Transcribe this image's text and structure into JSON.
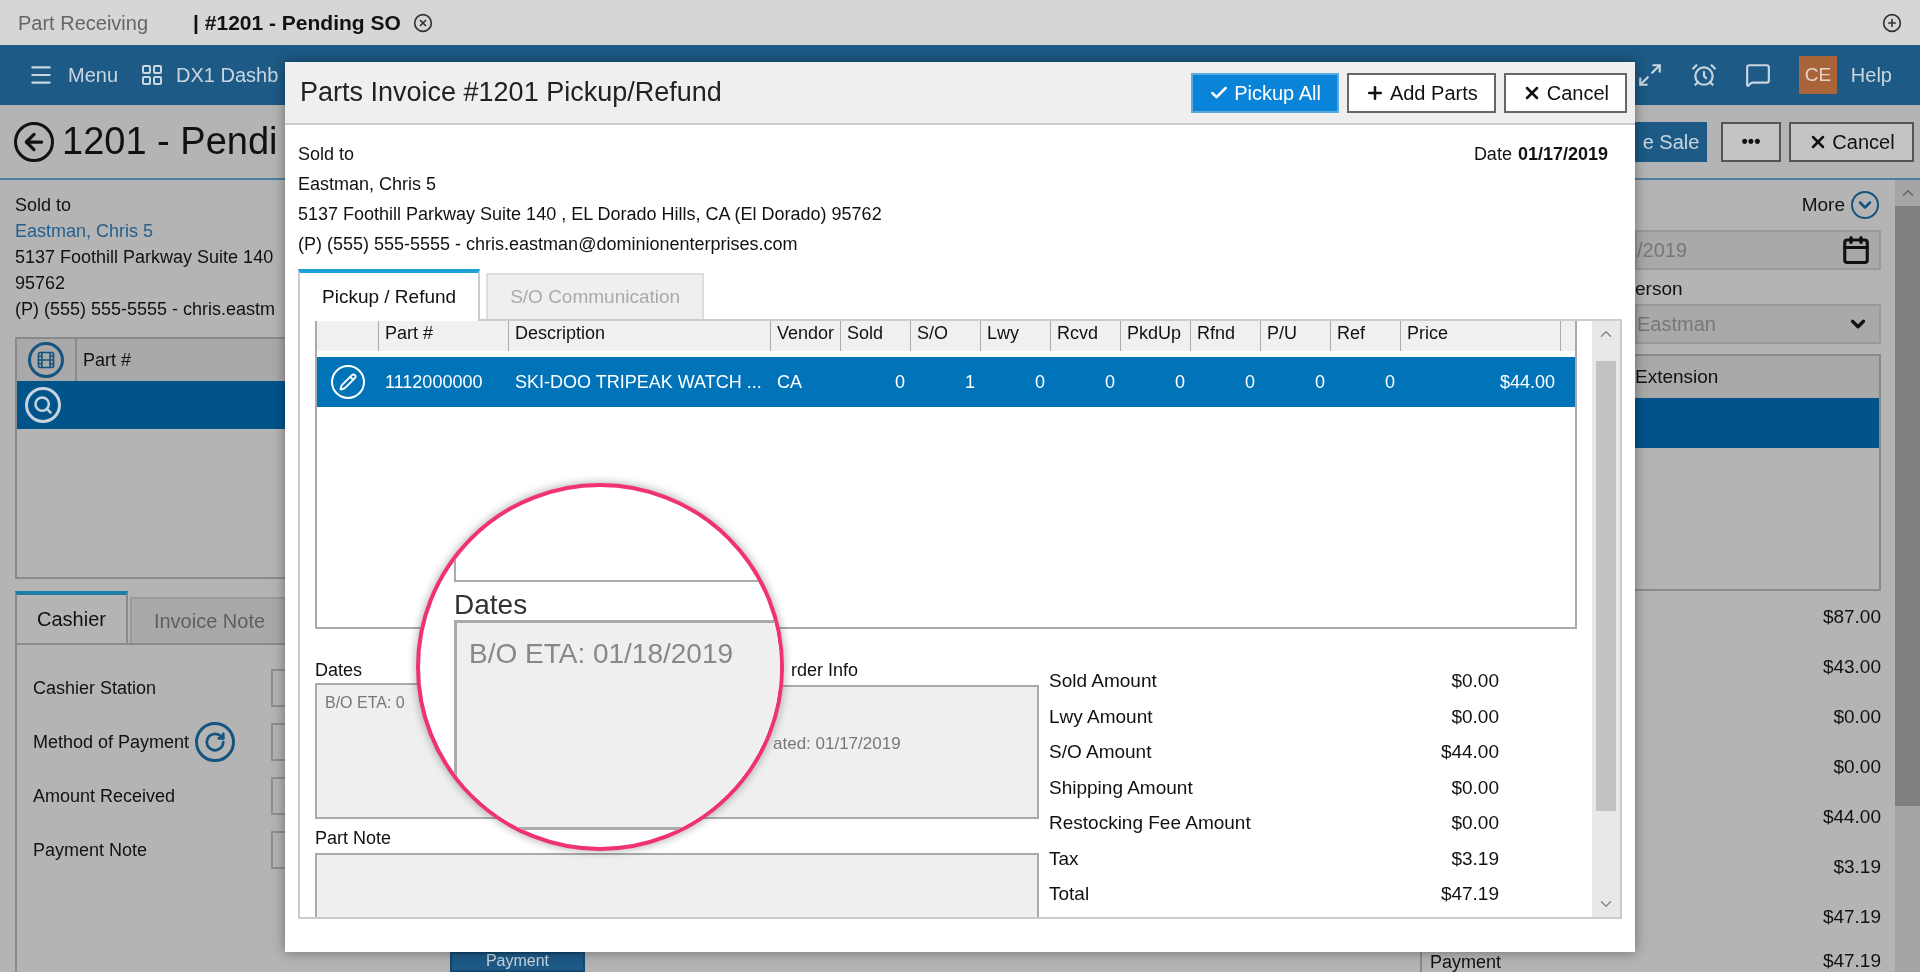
{
  "tabbar": {
    "app_tab": "Part Receiving",
    "doc_tab": "| #1201 - Pending SO"
  },
  "nav": {
    "menu": "Menu",
    "dashboard": "DX1 Dashb",
    "avatar": "CE",
    "help": "Help"
  },
  "page": {
    "title": "1201 - Pendi",
    "sale_button": "e Sale",
    "more_button": "•••",
    "cancel_button": "Cancel"
  },
  "left": {
    "sold_to_label": "Sold to",
    "customer": "Eastman, Chris 5",
    "address": "5137 Foothill Parkway Suite 140",
    "zip": "95762",
    "contact": "(P) (555) 555-5555 - chris.eastm",
    "grid_header": "Part #",
    "tabs": [
      {
        "label": "Cashier",
        "selected": true
      },
      {
        "label": "Invoice Note",
        "selected": false
      }
    ],
    "fields": [
      {
        "label": "Cashier Station",
        "kind": "plain"
      },
      {
        "label": "Method of Payment",
        "kind": "refresh"
      },
      {
        "label": "Amount Received",
        "kind": "plain"
      },
      {
        "label": "Payment Note",
        "kind": "plain"
      }
    ]
  },
  "right": {
    "more": "More",
    "date_value": "/2019",
    "person_label": "erson",
    "person_value": "Eastman",
    "grid_header": "Extension",
    "amounts": [
      "$87.00",
      "$43.00",
      "$0.00",
      "$0.00",
      "$44.00",
      "$3.19",
      "$47.19"
    ],
    "payment_label": "Payment",
    "payment_amount": "$47.19"
  },
  "payment_button": "Payment",
  "dialog": {
    "title": "Parts Invoice #1201 Pickup/Refund",
    "buttons": [
      {
        "label": "Pickup All",
        "kind": "confirm"
      },
      {
        "label": "Add Parts",
        "kind": "add"
      },
      {
        "label": "Cancel",
        "kind": "cancel"
      }
    ],
    "sold_to_label": "Sold to",
    "customer": "Eastman, Chris 5",
    "address": "5137 Foothill Parkway Suite 140 , EL Dorado Hills, CA (El Dorado) 95762",
    "contact": "(P) (555) 555-5555 - chris.eastman@dominionenterprises.com",
    "date_label": "Date",
    "date_value": "01/17/2019",
    "tabs": [
      {
        "label": "Pickup / Refund",
        "selected": true
      },
      {
        "label": "S/O Communication",
        "selected": false
      }
    ],
    "columns": [
      "Part #",
      "Description",
      "Vendor",
      "Sold",
      "S/O",
      "Lwy",
      "Rcvd",
      "PkdUp",
      "Rfnd",
      "P/U",
      "Ref",
      "Price"
    ],
    "rows": [
      {
        "selected": true,
        "cells": [
          "1112000000",
          "SKI-DOO TRIPEAK WATCH ...",
          "CA",
          "0",
          "1",
          "0",
          "0",
          "0",
          "0",
          "0",
          "0",
          "$44.00"
        ]
      }
    ],
    "dates_label": "Dates",
    "dates_value": "B/O ETA: 0",
    "order_label": "rder Info",
    "order_value": "ated: 01/17/2019",
    "part_note_label": "Part Note",
    "totals": [
      {
        "label": "Sold Amount",
        "value": "$0.00"
      },
      {
        "label": "Lwy Amount",
        "value": "$0.00"
      },
      {
        "label": "S/O Amount",
        "value": "$44.00"
      },
      {
        "label": "Shipping Amount",
        "value": "$0.00"
      },
      {
        "label": "Restocking Fee Amount",
        "value": "$0.00"
      },
      {
        "label": "Tax",
        "value": "$3.19"
      },
      {
        "label": "Total",
        "value": "$47.19"
      }
    ]
  },
  "magnifier": {
    "label": "Dates",
    "value": "B/O ETA: 01/18/2019"
  }
}
